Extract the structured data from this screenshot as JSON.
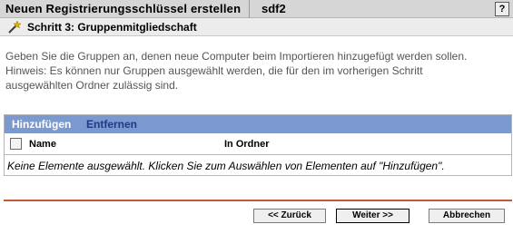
{
  "window": {
    "title": "Neuen Registrierungsschlüssel erstellen",
    "subtitle": "sdf2",
    "help_label": "?"
  },
  "step": {
    "icon": "magic-wand-icon",
    "title": "Schritt 3: Gruppenmitgliedschaft"
  },
  "description": {
    "line1": "Geben Sie die Gruppen an, denen neue Computer beim Importieren hinzugefügt werden sollen.",
    "line2": "Hinweis: Es können nur Gruppen ausgewählt werden, die für den im vorherigen Schritt",
    "line3": "ausgewählten Ordner zulässig sind."
  },
  "groups": {
    "add_label": "Hinzufügen",
    "remove_label": "Entfernen",
    "columns": [
      "Name",
      "In Ordner"
    ],
    "empty_message": "Keine Elemente ausgewählt. Klicken Sie zum Auswählen von Elementen auf \"Hinzufügen\"."
  },
  "buttons": {
    "back": "<< Zurück",
    "next": "Weiter >>",
    "cancel": "Abbrechen"
  },
  "colors": {
    "panel_header": "#7b98cf",
    "divider": "#c45a3a",
    "remove_link": "#1f3a8a"
  }
}
